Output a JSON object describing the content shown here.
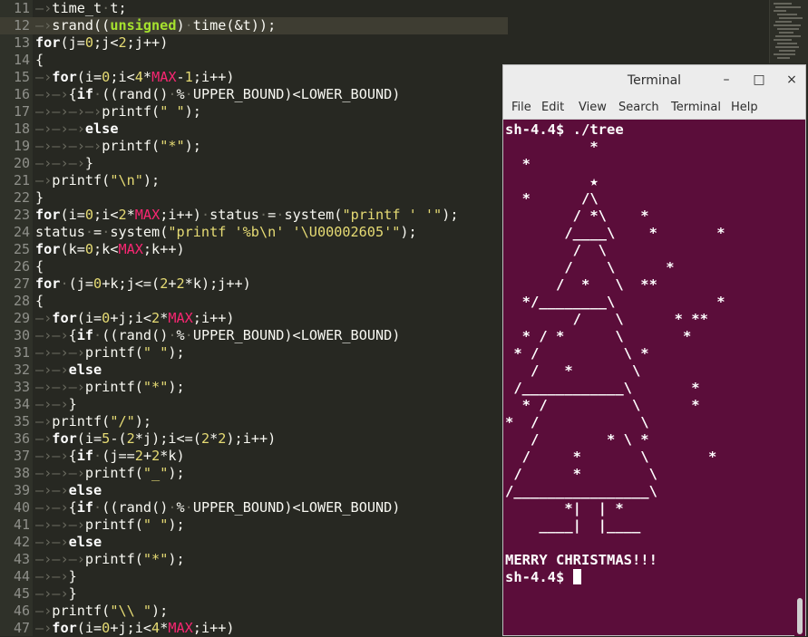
{
  "editor": {
    "current_line": 12,
    "tab_marker": "—›",
    "lines": [
      {
        "n": "11",
        "code": "⇥time_t·t;"
      },
      {
        "n": "12",
        "code": "⇥srand((unsigned)·time(&t));"
      },
      {
        "n": "13",
        "code": "for(j=0;j<2;j++)"
      },
      {
        "n": "14",
        "code": "{"
      },
      {
        "n": "15",
        "code": "⇥for(i=0;i<4*MAX-1;i++)"
      },
      {
        "n": "16",
        "code": "⇥⇥{if·((rand()·%·UPPER_BOUND)<LOWER_BOUND)"
      },
      {
        "n": "17",
        "code": "⇥⇥⇥⇥printf(\"·\");"
      },
      {
        "n": "18",
        "code": "⇥⇥⇥else"
      },
      {
        "n": "19",
        "code": "⇥⇥⇥⇥printf(\"*\");"
      },
      {
        "n": "20",
        "code": "⇥⇥⇥}"
      },
      {
        "n": "21",
        "code": "⇥printf(\"\\n\");"
      },
      {
        "n": "22",
        "code": "}"
      },
      {
        "n": "23",
        "code": "for(i=0;i<2*MAX;i++)·status·=·system(\"printf·'·'\");"
      },
      {
        "n": "24",
        "code": "status·=·system(\"printf·'%b\\n'·'\\U00002605'\");"
      },
      {
        "n": "25",
        "code": "for(k=0;k<MAX;k++)"
      },
      {
        "n": "26",
        "code": "{"
      },
      {
        "n": "27",
        "code": "for·(j=0+k;j<=(2+2*k);j++)"
      },
      {
        "n": "28",
        "code": "{"
      },
      {
        "n": "29",
        "code": "⇥for(i=0+j;i<2*MAX;i++)"
      },
      {
        "n": "30",
        "code": "⇥⇥{if·((rand()·%·UPPER_BOUND)<LOWER_BOUND)"
      },
      {
        "n": "31",
        "code": "⇥⇥⇥printf(\"·\");"
      },
      {
        "n": "32",
        "code": "⇥⇥else"
      },
      {
        "n": "33",
        "code": "⇥⇥⇥printf(\"*\");"
      },
      {
        "n": "34",
        "code": "⇥⇥}"
      },
      {
        "n": "35",
        "code": "⇥printf(\"/\");"
      },
      {
        "n": "36",
        "code": "⇥for(i=5-(2*j);i<=(2*2);i++)"
      },
      {
        "n": "37",
        "code": "⇥⇥{if·(j==2+2*k)"
      },
      {
        "n": "38",
        "code": "⇥⇥⇥printf(\"_\");"
      },
      {
        "n": "39",
        "code": "⇥⇥else"
      },
      {
        "n": "40",
        "code": "⇥⇥{if·((rand()·%·UPPER_BOUND)<LOWER_BOUND)"
      },
      {
        "n": "41",
        "code": "⇥⇥⇥printf(\"·\");"
      },
      {
        "n": "42",
        "code": "⇥⇥else"
      },
      {
        "n": "43",
        "code": "⇥⇥⇥printf(\"*\");"
      },
      {
        "n": "44",
        "code": "⇥⇥}"
      },
      {
        "n": "45",
        "code": "⇥⇥}"
      },
      {
        "n": "46",
        "code": "⇥printf(\"\\\\·\");"
      },
      {
        "n": "47",
        "code": "⇥for(i=0+j;i<4*MAX;i++)"
      }
    ]
  },
  "terminal": {
    "title": "Terminal",
    "controls": {
      "minimize": "–",
      "maximize": "□",
      "close": "×"
    },
    "menu": [
      "File",
      "Edit",
      "View",
      "Search",
      "Terminal",
      "Help"
    ],
    "lines": [
      "sh-4.4$ ./tree",
      "          *",
      "  *",
      "          ★",
      "  *      /\\",
      "        / *\\    *",
      "       /____\\    *       *",
      "        /  \\",
      "       /    \\      *",
      "      /  *   \\  **",
      "  */________\\            *",
      "        /    \\      * **",
      "  * / *      \\       *",
      " * /          \\ *",
      "   /   *       \\",
      " /____________\\       *",
      "  * /          \\      *",
      "*  /            \\",
      "   /        * \\ *",
      "  /     *       \\       *",
      " /      *        \\",
      "/________________\\",
      "       *|  | *",
      "    ____|  |____",
      "",
      "MERRY CHRISTMAS!!!",
      "sh-4.4$ "
    ]
  },
  "colors": {
    "editor_bg": "#272822",
    "terminal_bg": "#5b0d3a",
    "keyword": "#ffffff",
    "number": "#e6db74",
    "macro": "#f92672",
    "type": "#a6e22e"
  }
}
